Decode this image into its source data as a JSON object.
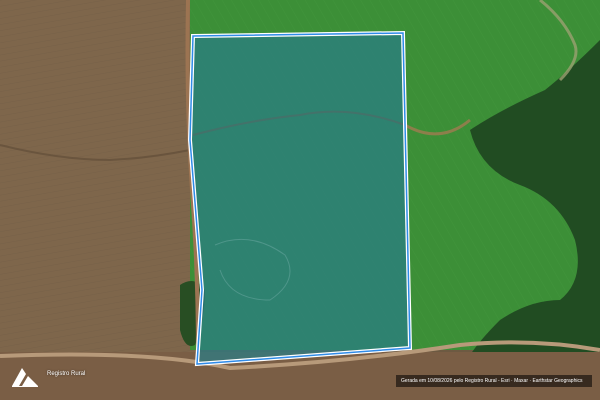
{
  "map": {
    "brand_label": "Registro Rural",
    "attribution": "Gerada em 10/08/2026 pelo Registro Rural - Esri · Maxar · Earthstar Geographics",
    "colors": {
      "field_brown": "#7a6248",
      "field_green": "#3e8f3a",
      "forest": "#1f4a22",
      "road": "#b9a58c",
      "parcel_fill": "#2a7d86",
      "parcel_stroke": "#ffffff",
      "parcel_inner_stroke": "#2f8be8"
    },
    "icons": [
      "registro-rural-logo-icon"
    ]
  }
}
